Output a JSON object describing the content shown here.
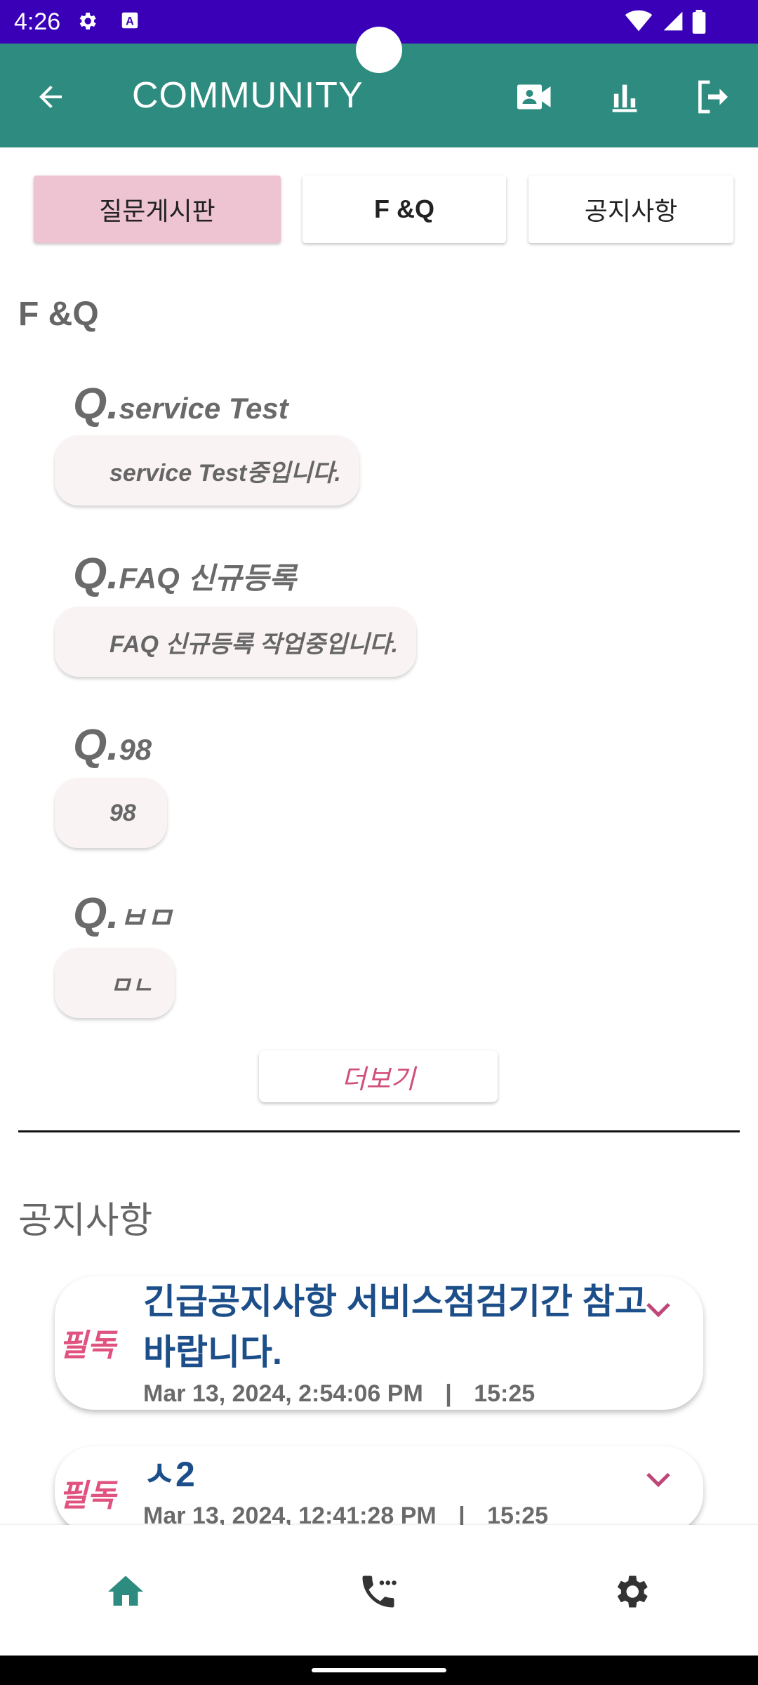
{
  "status_bar": {
    "time": "4:26",
    "color": "#3a00b8"
  },
  "app_bar": {
    "title": "COMMUNITY",
    "color": "#2e8b7f",
    "icons": [
      "arrow-back-icon",
      "video-call-icon",
      "bar-chart-icon",
      "logout-icon"
    ]
  },
  "tabs": [
    {
      "label": "질문게시판",
      "active": true
    },
    {
      "label": "F &Q",
      "active": false
    },
    {
      "label": "공지사항",
      "active": false
    }
  ],
  "faq": {
    "title": "F &Q",
    "q_prefix": "Q.",
    "items": [
      {
        "question": "service Test",
        "answer": "service Test중입니다."
      },
      {
        "question": "FAQ 신규등록",
        "answer": "FAQ 신규등록 작업중입니다."
      },
      {
        "question": "98",
        "answer": "98"
      },
      {
        "question": "ㅂㅁ",
        "answer": "ㅁㄴ"
      }
    ],
    "more_label": "더보기"
  },
  "notices": {
    "title": "공지사항",
    "items": [
      {
        "badge": "필독",
        "title": "긴급공지사항 서비스점검기간 참고바랍니다.",
        "date": "Mar 13, 2024, 2:54:06 PM",
        "separator": "|",
        "time": "15:25"
      },
      {
        "badge": "필독",
        "title": "ㅅ2",
        "date": "Mar 13, 2024, 12:41:28 PM",
        "separator": "|",
        "time": "15:25"
      }
    ]
  },
  "bottom_nav": {
    "items": [
      "home-icon",
      "phone-icon",
      "settings-icon"
    ],
    "active_color": "#2e8b7f"
  }
}
